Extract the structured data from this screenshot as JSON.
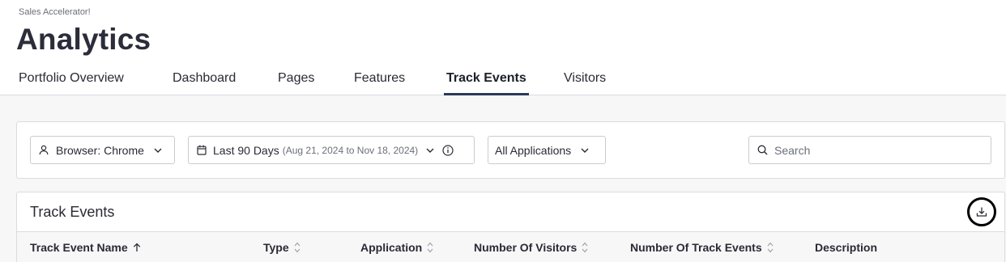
{
  "header": {
    "app_name": "Sales Accelerator!",
    "title": "Analytics",
    "tabs": [
      {
        "label": "Portfolio Overview",
        "active": false
      },
      {
        "label": "Dashboard",
        "active": false
      },
      {
        "label": "Pages",
        "active": false
      },
      {
        "label": "Features",
        "active": false
      },
      {
        "label": "Track Events",
        "active": true
      },
      {
        "label": "Visitors",
        "active": false
      }
    ]
  },
  "filters": {
    "segment": {
      "label": "Browser: Chrome",
      "icon": "user-icon"
    },
    "date_range": {
      "label": "Last 90 Days",
      "sub": "(Aug 21, 2024 to Nov 18, 2024)",
      "icon": "calendar-icon"
    },
    "applications": {
      "label": "All Applications"
    },
    "search": {
      "placeholder": "Search",
      "value": ""
    }
  },
  "table": {
    "title": "Track Events",
    "columns": [
      {
        "label": "Track Event Name",
        "sort": "ascending"
      },
      {
        "label": "Type",
        "sort": "none"
      },
      {
        "label": "Application",
        "sort": "none"
      },
      {
        "label": "Number Of Visitors",
        "sort": "none"
      },
      {
        "label": "Number Of Track Events",
        "sort": "none"
      },
      {
        "label": "Description",
        "sort": null
      }
    ]
  },
  "colors": {
    "active_tab_underline": "#2b3a57",
    "background": "#f7f7f8",
    "text": "#2a2a35"
  }
}
